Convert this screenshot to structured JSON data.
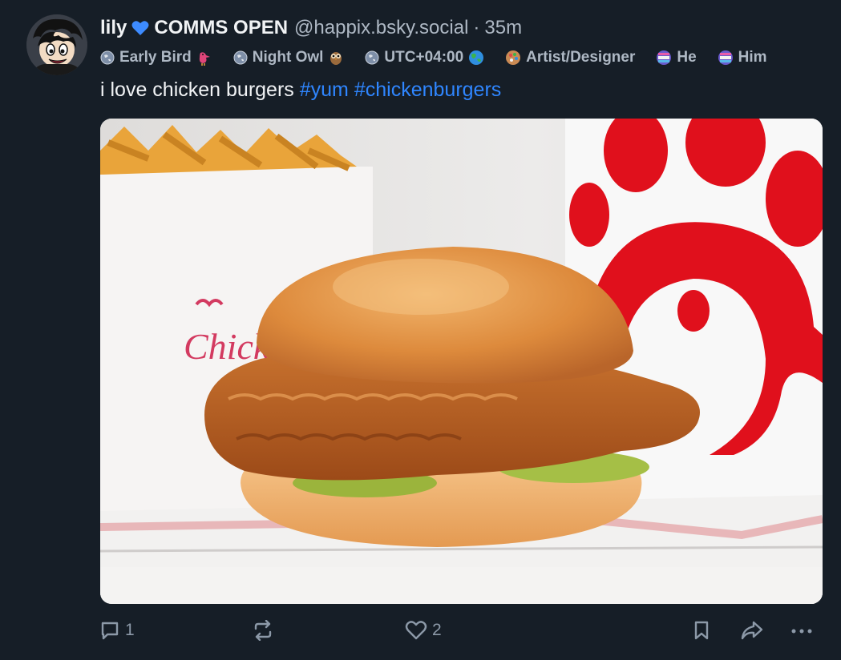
{
  "post": {
    "author": {
      "display_name": "lily",
      "name_emoji": "💙",
      "status": "COMMS OPEN",
      "handle": "@happix.bsky.social",
      "separator": "·",
      "time_ago": "35m"
    },
    "badges": [
      {
        "icon": "globe-icon",
        "label": "Early Bird",
        "tail_icon": "bird-icon"
      },
      {
        "icon": "globe-icon",
        "label": "Night Owl",
        "tail_icon": "owl-icon"
      },
      {
        "icon": "globe-icon",
        "label": "UTC+04:00",
        "tail_icon": "earth-icon"
      },
      {
        "icon": "palette-icon",
        "label": "Artist/Designer"
      },
      {
        "icon": "pronoun-icon",
        "label": "He"
      },
      {
        "icon": "pronoun-icon",
        "label": "Him"
      }
    ],
    "text": "i love chicken burgers",
    "hashtags": [
      "#yum",
      "#chickenburgers"
    ],
    "image": {
      "alt": "chicken sandwich with waffle fries and drink cup"
    },
    "actions": {
      "reply_count": "1",
      "repost_count": "",
      "like_count": "2"
    }
  },
  "colors": {
    "background": "#161e27",
    "text": "#f1f3f5",
    "muted": "#aeb8c4",
    "link": "#2f86ff",
    "icon": "#8c99a8"
  }
}
